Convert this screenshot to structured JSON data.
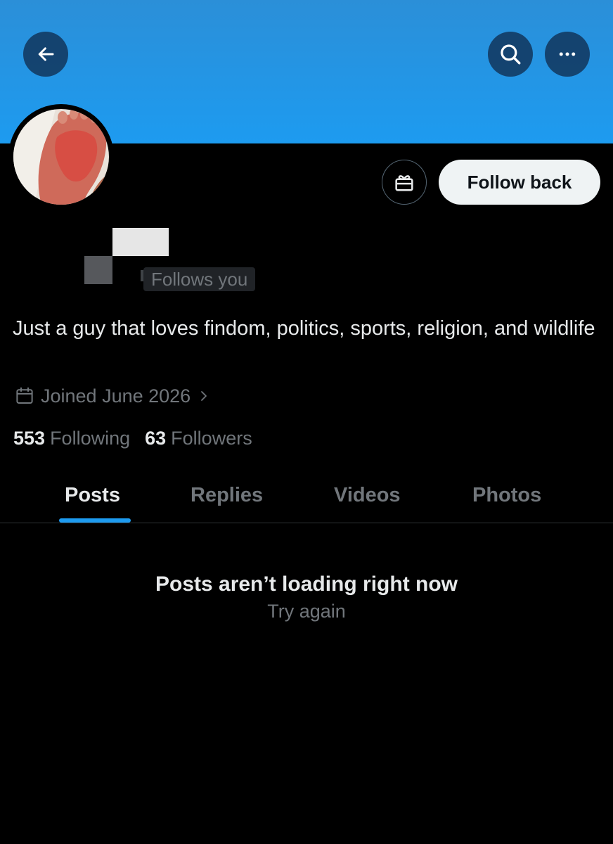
{
  "header": {
    "back_icon": "arrow-left-icon",
    "search_icon": "search-icon",
    "more_icon": "more-horizontal-icon",
    "banner_color": "#1d9bf0"
  },
  "profile": {
    "avatar_description": "profile photo",
    "gift_icon": "gift-icon",
    "follow_back_label": "Follow back",
    "follows_you_label": "Follows you",
    "bio": "Just a guy that loves findom, politics, sports, religion, and wildlife",
    "joined_icon": "calendar-icon",
    "joined": "Joined June 2026",
    "chevron_icon": "chevron-right-icon",
    "following_count": "553",
    "following_label": "Following",
    "followers_count": "63",
    "followers_label": "Followers"
  },
  "tabs": [
    {
      "label": "Posts",
      "active": true
    },
    {
      "label": "Replies",
      "active": false
    },
    {
      "label": "Videos",
      "active": false
    },
    {
      "label": "Photos",
      "active": false
    }
  ],
  "feed": {
    "error_title": "Posts aren’t loading right now",
    "retry_label": "Try again"
  },
  "colors": {
    "accent": "#1d9bf0",
    "background": "#000000",
    "primary_text": "#e7e9ea",
    "secondary_text": "#71767b"
  }
}
